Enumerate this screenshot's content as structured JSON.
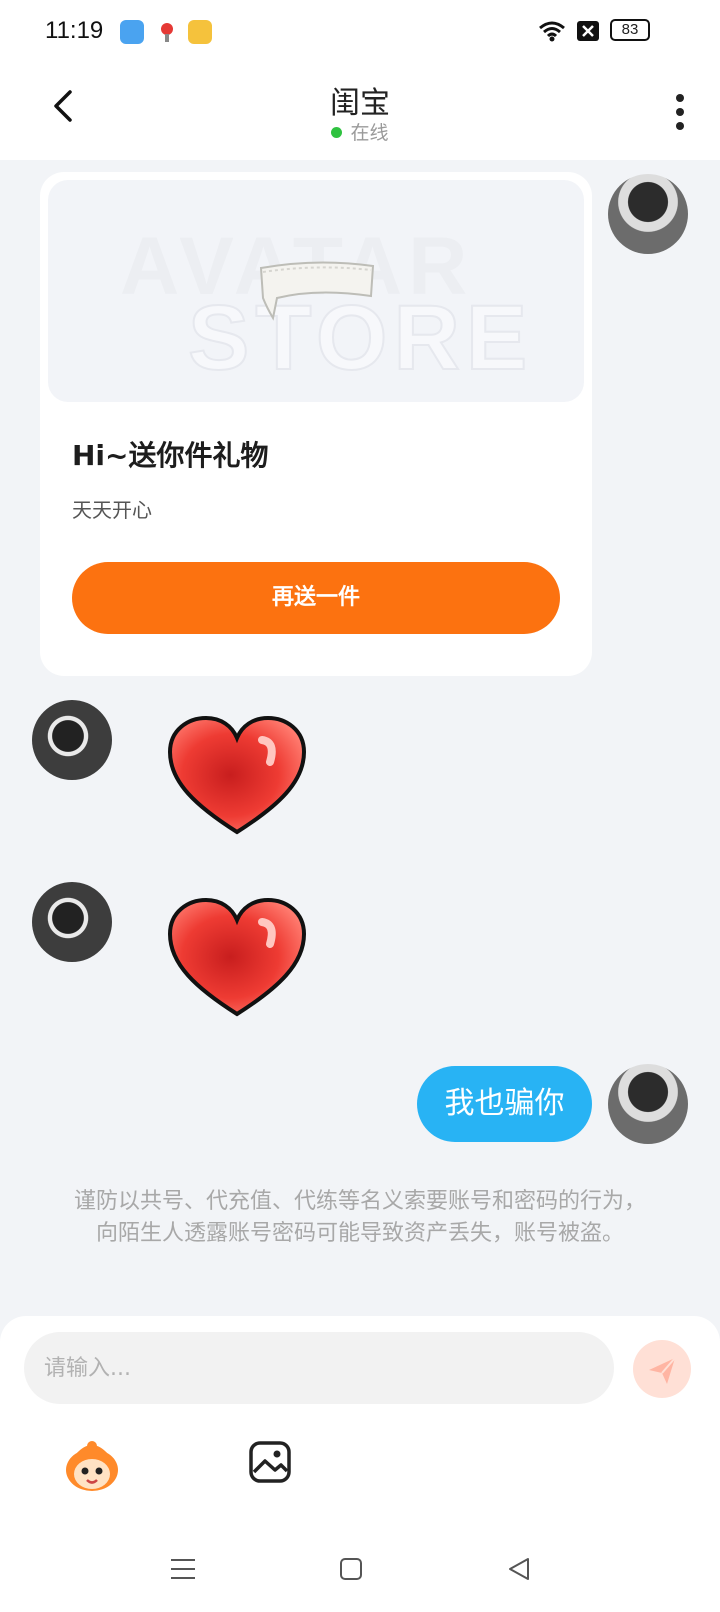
{
  "status_bar": {
    "time": "11:19",
    "battery": "83"
  },
  "header": {
    "title": "闺宝",
    "status": "在线"
  },
  "gift_card": {
    "watermark_line1": "AVATAR",
    "watermark_line2": "STORE",
    "title": "Hi~送你件礼物",
    "subtitle": "天天开心",
    "button_label": "再送一件"
  },
  "messages": {
    "sent_text": "我也骗你"
  },
  "warning_text": "谨防以共号、代充值、代练等名义索要账号和密码的行为，向陌生人透露账号密码可能导致资产丢失，账号被盗。",
  "composer": {
    "placeholder": "请输入..."
  },
  "colors": {
    "accent": "#fc7210",
    "bubble": "#28b3f4",
    "online": "#2fc240"
  }
}
